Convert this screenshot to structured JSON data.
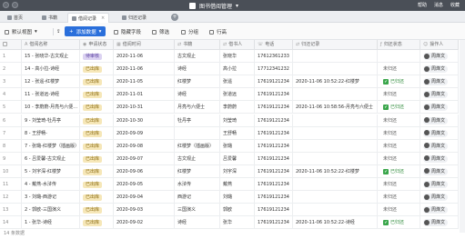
{
  "window": {
    "title": "图书借阅管理",
    "right_items": [
      "帮助",
      "消息",
      "收藏"
    ]
  },
  "tabs": [
    {
      "label": "首页",
      "active": false
    },
    {
      "label": "书籍",
      "active": false
    },
    {
      "label": "借阅记录",
      "active": true
    },
    {
      "label": "归还记录",
      "active": false
    }
  ],
  "toolbar": {
    "view": "默认视图",
    "add": "添加数据",
    "hide_fields": "隐藏字段",
    "filter": "筛选",
    "group": "分组",
    "row_height": "行高"
  },
  "columns": [
    "借阅名称",
    "申请状态",
    "借阅时间",
    "书籍",
    "借书人",
    "电话",
    "归还记录",
    "归还状态",
    "操作人"
  ],
  "rows": [
    {
      "n": "1",
      "name": "15 - 张晓华-古文观止",
      "status": "待审核",
      "time": "2020-11-06",
      "book": "古文观止",
      "person": "张晓华",
      "phone": "17612361233",
      "ret": "",
      "rstatus": "",
      "op": "周烽文"
    },
    {
      "n": "2",
      "name": "14 - 高小拉-诗经",
      "status": "已出库",
      "time": "2020-11-06",
      "book": "诗经",
      "person": "高小拉",
      "phone": "17712341232",
      "ret": "",
      "rstatus": "未归还",
      "op": "周烽文"
    },
    {
      "n": "3",
      "name": "12 - 张遥-红楼梦",
      "status": "已出库",
      "time": "2020-11-05",
      "book": "红楼梦",
      "person": "张遥",
      "phone": "17619121234",
      "ret": "2020-11-06 10:52:22-红楼梦",
      "rstatus": "已归还",
      "op": "周烽文"
    },
    {
      "n": "4",
      "name": "11 - 张道远-诗经",
      "status": "已出库",
      "time": "2020-11-01",
      "book": "诗经",
      "person": "张道远",
      "phone": "17619121234",
      "ret": "",
      "rstatus": "未归还",
      "op": "周烽文"
    },
    {
      "n": "5",
      "name": "10 - 李蔚蔚-月亮与六便…",
      "status": "已出库",
      "time": "2020-10-31",
      "book": "月亮与六便士",
      "person": "李蔚蔚",
      "phone": "17619121234",
      "ret": "2020-11-06 10:58:56-月亮与六便士",
      "rstatus": "已归还",
      "op": "周烽文"
    },
    {
      "n": "6",
      "name": "9 - 刘莹琦-牡丹亭",
      "status": "已出库",
      "time": "2020-10-30",
      "book": "牡丹亭",
      "person": "刘莹琦",
      "phone": "17619121234",
      "ret": "",
      "rstatus": "未归还",
      "op": "周烽文"
    },
    {
      "n": "7",
      "name": "8 - 王舒畅-",
      "status": "已出库",
      "time": "2020-09-09",
      "book": "",
      "person": "王舒畅",
      "phone": "17619121234",
      "ret": "",
      "rstatus": "未归还",
      "op": "周烽文"
    },
    {
      "n": "8",
      "name": "7 - 张璐-红楼梦（插画版）",
      "status": "已出库",
      "time": "2020-09-08",
      "book": "红楼梦（插画版）",
      "person": "张璐",
      "phone": "17619121234",
      "ret": "",
      "rstatus": "未归还",
      "op": "周烽文"
    },
    {
      "n": "9",
      "name": "6 - 吕爱馨-古文观止",
      "status": "已出库",
      "time": "2020-09-07",
      "book": "古文观止",
      "person": "吕爱馨",
      "phone": "17619121234",
      "ret": "",
      "rstatus": "未归还",
      "op": "周烽文"
    },
    {
      "n": "10",
      "name": "5 - 刘宇深-红楼梦",
      "status": "已出库",
      "time": "2020-09-06",
      "book": "红楼梦",
      "person": "刘宇深",
      "phone": "17619121234",
      "ret": "2020-11-06 10:52:22-红楼梦",
      "rstatus": "已归还",
      "op": "周烽文"
    },
    {
      "n": "11",
      "name": "4 - 戴燕-水浒传",
      "status": "已出库",
      "time": "2020-09-05",
      "book": "水浒传",
      "person": "戴燕",
      "phone": "17619121234",
      "ret": "",
      "rstatus": "未归还",
      "op": "周烽文"
    },
    {
      "n": "12",
      "name": "3 - 刘璐-西游记",
      "status": "已出库",
      "time": "2020-09-04",
      "book": "西游记",
      "person": "刘璐",
      "phone": "17619121234",
      "ret": "",
      "rstatus": "未归还",
      "op": "周烽文"
    },
    {
      "n": "13",
      "name": "2 - 郭欧-三国演义",
      "status": "已出库",
      "time": "2020-09-03",
      "book": "三国演义",
      "person": "郭欧",
      "phone": "17619121234",
      "ret": "",
      "rstatus": "未归还",
      "op": "周烽文"
    },
    {
      "n": "14",
      "name": "1 - 张华-诗经",
      "status": "已出库",
      "time": "2020-09-02",
      "book": "诗经",
      "person": "张华",
      "phone": "17619121234",
      "ret": "2020-11-06 10:52:22-诗经",
      "rstatus": "已归还",
      "op": "周烽文"
    }
  ],
  "footer": "14 条数据"
}
